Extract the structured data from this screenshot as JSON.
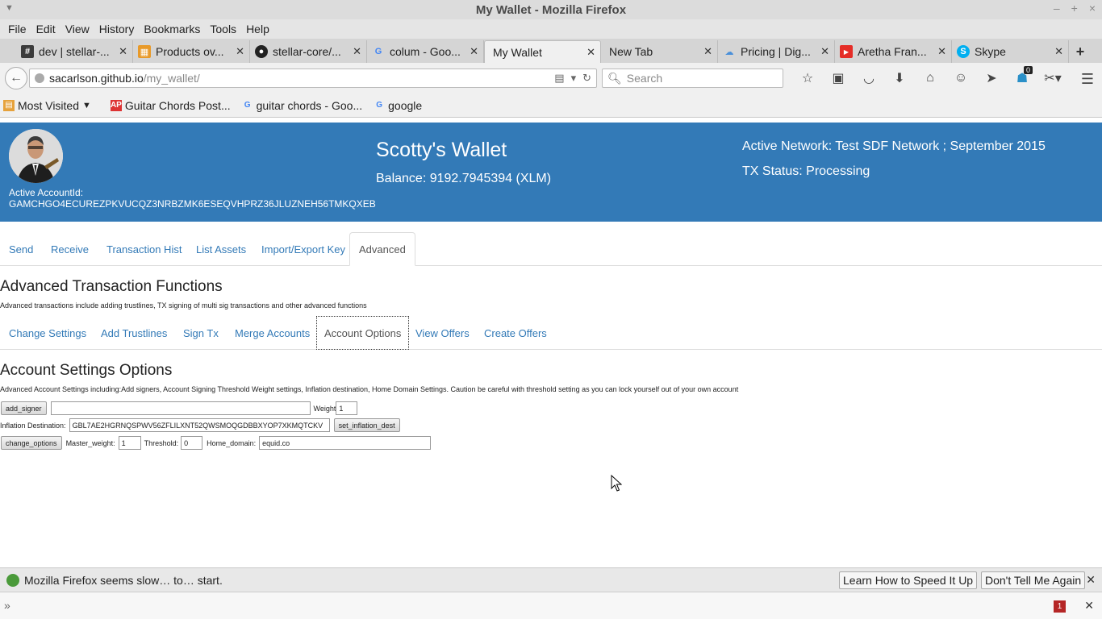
{
  "window": {
    "title": "My Wallet - Mozilla Firefox"
  },
  "menu": [
    "File",
    "Edit",
    "View",
    "History",
    "Bookmarks",
    "Tools",
    "Help"
  ],
  "tabs": [
    {
      "label": "dev | stellar-...",
      "icon": "hash-icon",
      "active": false
    },
    {
      "label": "Products ov...",
      "icon": "products-icon",
      "active": false
    },
    {
      "label": "stellar-core/...",
      "icon": "github-icon",
      "active": false
    },
    {
      "label": "colum - Goo...",
      "icon": "google-icon",
      "active": false
    },
    {
      "label": "My Wallet",
      "icon": "",
      "active": true
    },
    {
      "label": "New Tab",
      "icon": "",
      "active": false
    },
    {
      "label": "Pricing | Dig...",
      "icon": "cloud-icon",
      "active": false
    },
    {
      "label": "Aretha Fran...",
      "icon": "youtube-icon",
      "active": false
    },
    {
      "label": "Skype",
      "icon": "skype-icon",
      "active": false
    }
  ],
  "nav": {
    "url_host": "sacarlson.github.io",
    "url_path": "/my_wallet/",
    "search_placeholder": "Search",
    "notification_count": "0"
  },
  "bookmarks": [
    {
      "label": "Most Visited",
      "icon": "folder-icon"
    },
    {
      "label": "Guitar Chords Post...",
      "icon": "ap-icon"
    },
    {
      "label": "guitar chords - Goo...",
      "icon": "google-icon"
    },
    {
      "label": "google",
      "icon": "google-icon"
    }
  ],
  "header": {
    "account_label": "Active AccountId:",
    "account_id": "GAMCHGO4ECUREZPKVUCQZ3NRBZMK6ESEQVHPRZ36JLUZNEH56TMKQXEB",
    "wallet_title": "Scotty's Wallet",
    "balance": "Balance: 9192.7945394 (XLM)",
    "network": "Active Network: Test SDF Network ; September 2015",
    "tx_status": "TX Status: Processing"
  },
  "main_tabs": [
    "Send",
    "Receive",
    "Transaction Hist",
    "List Assets",
    "Import/Export Key",
    "Advanced"
  ],
  "advanced": {
    "heading": "Advanced Transaction Functions",
    "description": "Advanced transactions include adding trustlines, TX signing of multi sig transactions and other advanced functions",
    "sub_tabs": [
      "Change Settings",
      "Add Trustlines",
      "Sign Tx",
      "Merge Accounts",
      "Account Options",
      "View Offers",
      "Create Offers"
    ]
  },
  "account_options": {
    "heading": "Account Settings Options",
    "description": "Advanced Account Settings including:Add signers, Account Signing Threshold Weight settings, Inflation destination, Home Domain Settings. Caution be careful with threshold setting as you can lock yourself out of your own account",
    "add_signer_button": "add_signer",
    "signer_value": "",
    "weight_label": "Weight",
    "weight_value": "1",
    "inflation_label": "Inflation Destination:",
    "inflation_value": "GBL7AE2HGRNQSPWV56ZFLILXNT52QWSMOQGDBBXYOP7XKMQTCKV",
    "set_inflation_button": "set_inflation_dest",
    "change_options_button": "change_options",
    "master_weight_label": "Master_weight:",
    "master_weight_value": "1",
    "threshold_label": "Threshold:",
    "threshold_value": "0",
    "home_domain_label": "Home_domain:",
    "home_domain_value": "equid.co"
  },
  "notification": {
    "message": "Mozilla Firefox seems slow… to… start.",
    "learn_button": "Learn How to Speed It Up",
    "dont_tell_button": "Don't Tell Me Again"
  },
  "devtools": {
    "error_count": "1"
  }
}
